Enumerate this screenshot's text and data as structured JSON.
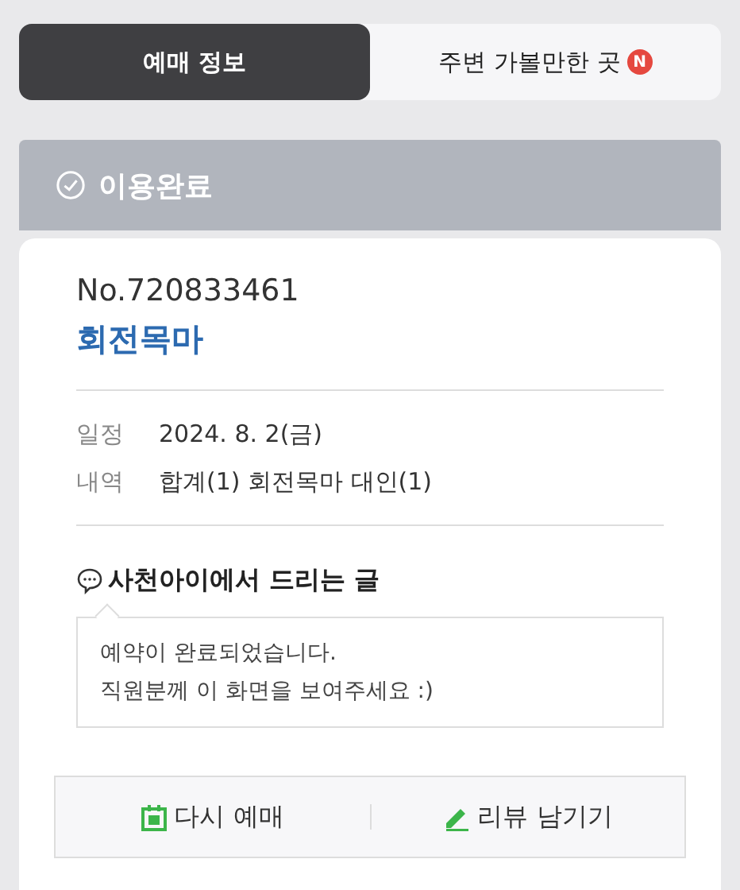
{
  "tabs": [
    {
      "label": "예매 정보",
      "selected": true
    },
    {
      "label": "주변 가볼만한 곳",
      "selected": false,
      "badge": "N"
    }
  ],
  "status": {
    "label": "이용완료"
  },
  "booking": {
    "number": "No.720833461",
    "title": "회전목마",
    "details": [
      {
        "label": "일정",
        "value": "2024. 8. 2(금)"
      },
      {
        "label": "내역",
        "value": "합계(1) 회전목마 대인(1)"
      }
    ]
  },
  "message": {
    "heading": "사천아이에서 드리는 글",
    "lines": [
      "예약이 완료되었습니다.",
      "직원분께 이 화면을 보여주세요 :)"
    ]
  },
  "actions": [
    {
      "kind": "rebook",
      "label": "다시 예매"
    },
    {
      "kind": "review",
      "label": "리뷰 남기기"
    }
  ]
}
